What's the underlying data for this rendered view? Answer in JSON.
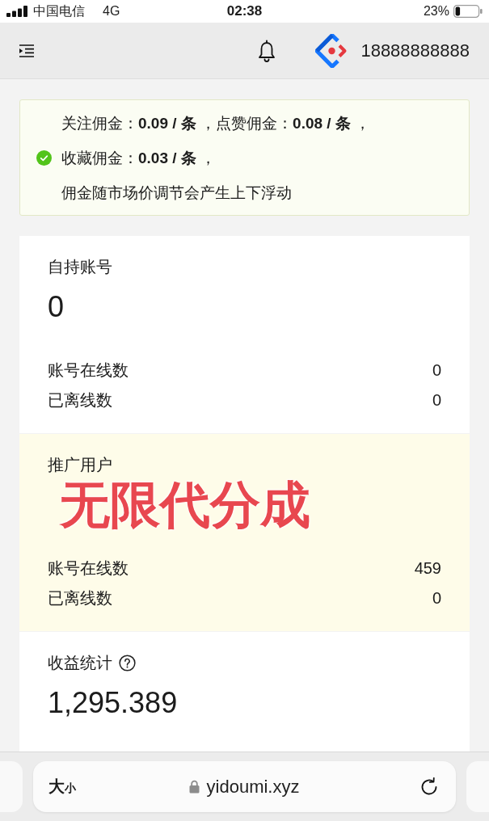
{
  "status_bar": {
    "carrier": "中国电信",
    "network": "4G",
    "time": "02:38",
    "battery": "23%"
  },
  "header": {
    "account": "18888888888"
  },
  "notice": {
    "kind": "success",
    "lines": [
      "关注佣金：**0.09 / 条** ，点赞佣金：**0.08 / 条** ，",
      "收藏佣金：**0.03 / 条** ，",
      "佣金随市场价调节会产生上下浮动"
    ]
  },
  "cards": [
    {
      "title": "自持账号",
      "value": "0",
      "highlighted": false,
      "rows": [
        {
          "label": "账号在线数",
          "value": "0"
        },
        {
          "label": "已离线数",
          "value": "0"
        }
      ]
    },
    {
      "title": "推广用户",
      "highlighted": true,
      "overlay": "无限代分成",
      "rows": [
        {
          "label": "账号在线数",
          "value": "459"
        },
        {
          "label": "已离线数",
          "value": "0"
        }
      ]
    },
    {
      "title": "收益统计",
      "help": true,
      "value": "1,295.389",
      "highlighted": false
    }
  ],
  "browser_bar": {
    "text_size": [
      "大",
      "小"
    ],
    "secure": true,
    "url": "yidoumi.xyz"
  }
}
